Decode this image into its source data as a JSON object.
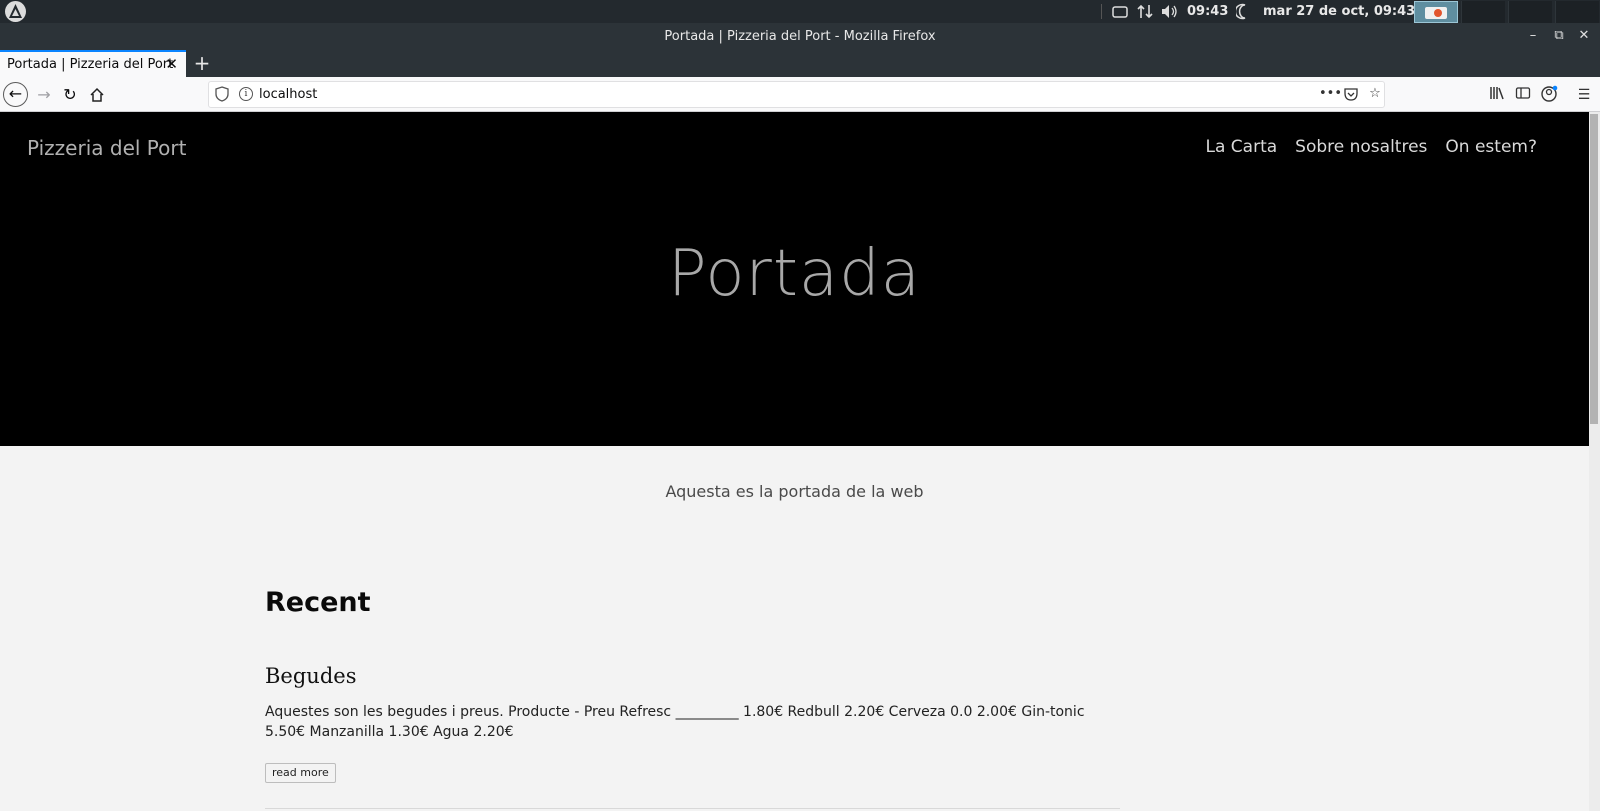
{
  "system": {
    "clock": "09:43",
    "date": "mar 27 de oct, 09:43"
  },
  "browser": {
    "window_title": "Portada | Pizzeria del Port - Mozilla Firefox",
    "tab_title": "Portada | Pizzeria del Port",
    "url": "localhost"
  },
  "site": {
    "brand": "Pizzeria del Port",
    "nav": [
      "La Carta",
      "Sobre nosaltres",
      "On estem?"
    ],
    "hero_title": "Portada",
    "lead": "Aquesta es la portada de la web",
    "recent_heading": "Recent",
    "posts": [
      {
        "title": "Begudes",
        "excerpt": "Aquestes son les begudes i preus. Producte - Preu Refresc _________ 1.80€ Redbull 2.20€ Cerveza 0.0 2.00€ Gin-tonic 5.50€ Manzanilla 1.30€ Agua 2.20€",
        "read_more": "read more"
      }
    ]
  }
}
